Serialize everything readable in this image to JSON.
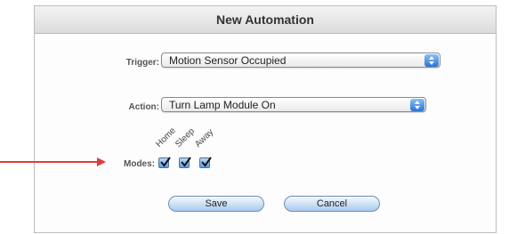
{
  "dialog": {
    "title": "New Automation",
    "trigger": {
      "label": "Trigger:",
      "value": "Motion Sensor Occupied"
    },
    "action": {
      "label": "Action:",
      "value": "Turn Lamp Module On"
    },
    "modes": {
      "label": "Modes:",
      "items": [
        {
          "name": "Home",
          "checked": true
        },
        {
          "name": "Sleep",
          "checked": true
        },
        {
          "name": "Away",
          "checked": true
        }
      ]
    },
    "buttons": {
      "save": "Save",
      "cancel": "Cancel"
    }
  },
  "annotation": {
    "arrow_color": "#e03c3c",
    "icon": "arrow-right-icon"
  }
}
